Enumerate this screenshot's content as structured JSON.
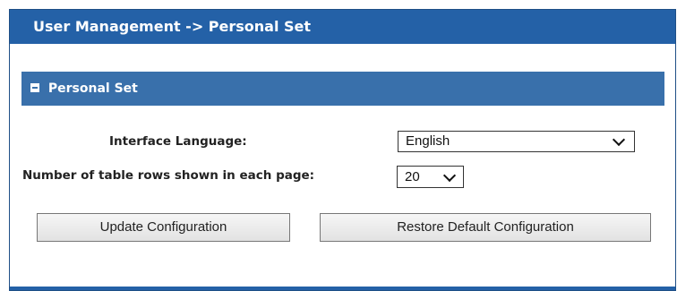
{
  "header": {
    "title": "User Management -> Personal Set"
  },
  "section": {
    "title": "Personal Set",
    "toggle_icon": "collapse-minus-icon"
  },
  "form": {
    "language": {
      "label": "Interface Language:",
      "selected": "English"
    },
    "rows_per_page": {
      "label": "Number of table rows shown in each page:",
      "selected": "20"
    }
  },
  "actions": {
    "update_label": "Update Configuration",
    "restore_label": "Restore Default Configuration"
  },
  "colors": {
    "header_bg": "#2461a7",
    "section_bg": "#3970ab",
    "button_bg": "#e8e8e8"
  }
}
